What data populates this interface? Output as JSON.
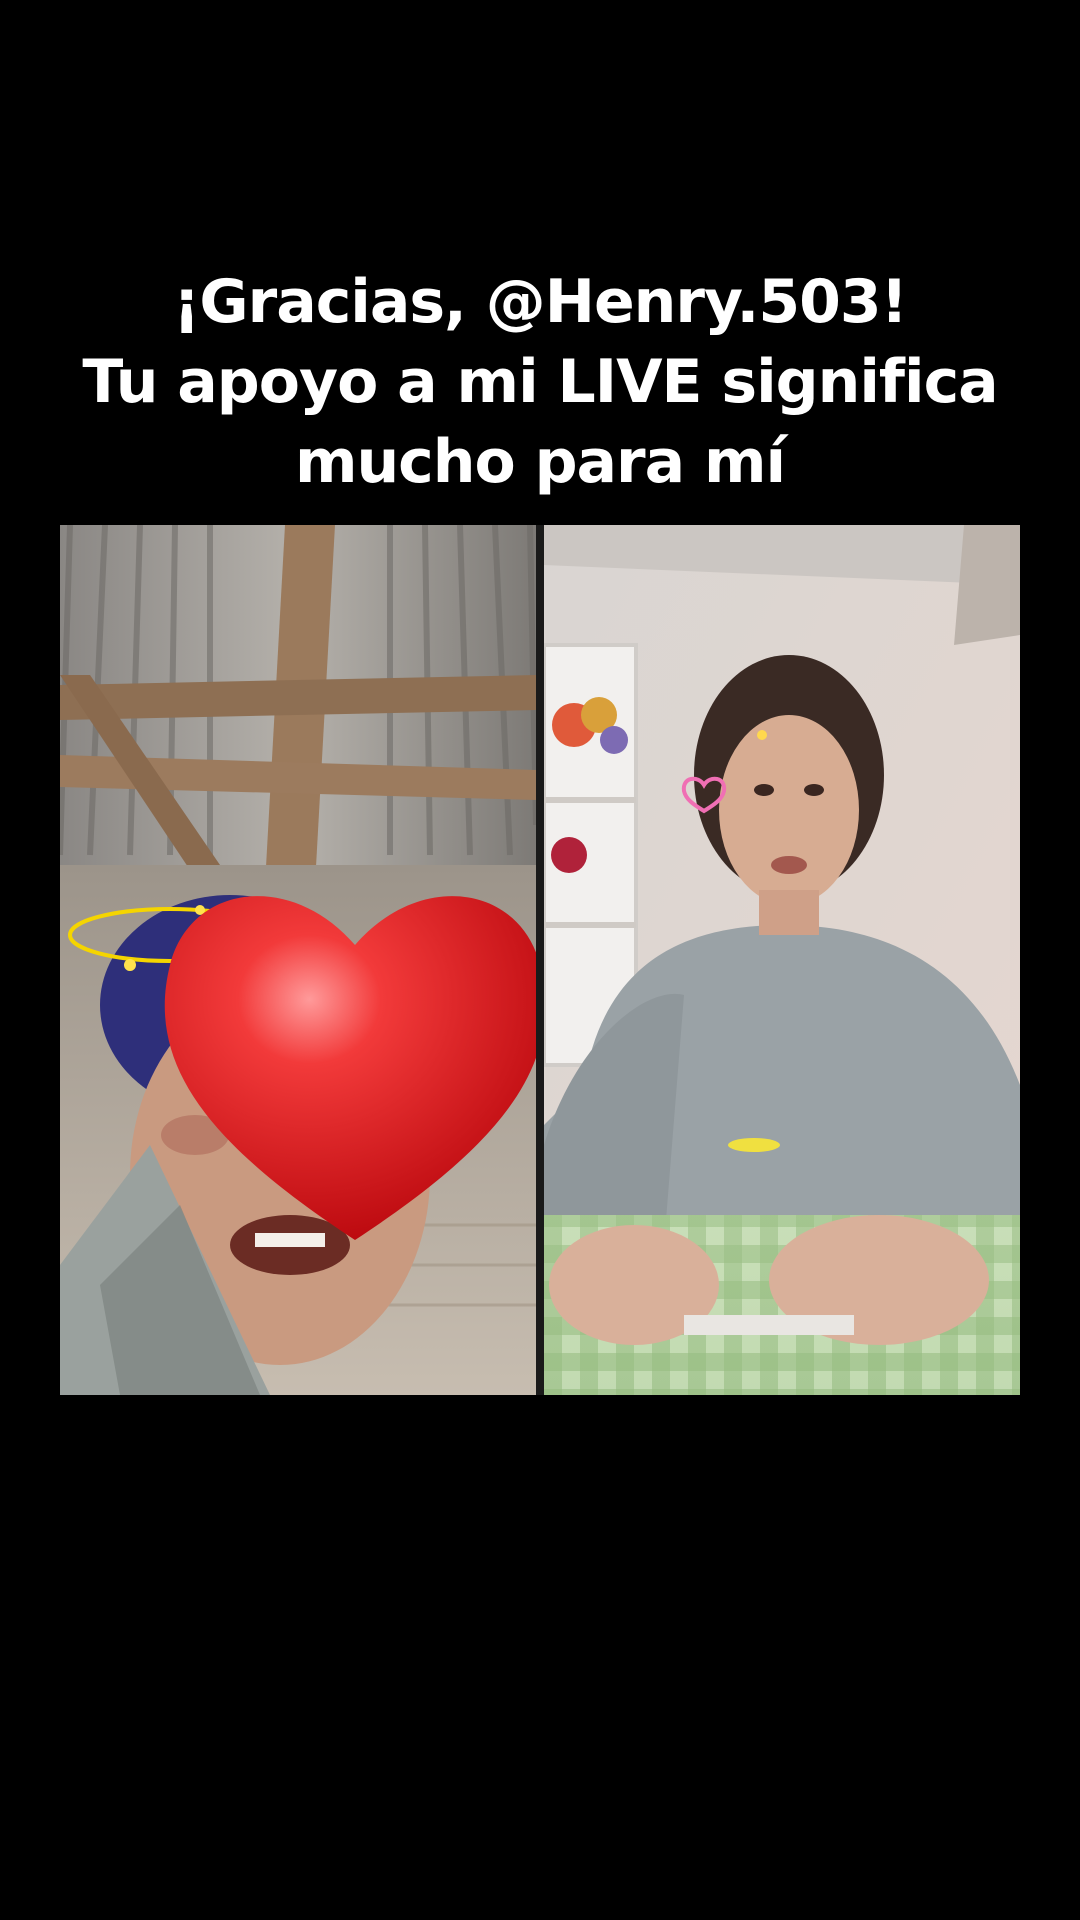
{
  "caption": {
    "line1": "¡Gracias, @Henry.503!",
    "line2": "Tu apoyo a mi LIVE significa",
    "line3": "mucho para mí"
  },
  "live": {
    "left_feed": {
      "subject": "guest-camera",
      "overlay_icon": "red-heart-icon"
    },
    "right_feed": {
      "subject": "host-camera",
      "overlay_icon": "pink-heart-sticker-icon"
    }
  },
  "colors": {
    "background": "#000000",
    "caption_text": "#ffffff",
    "heart": "#e0161b"
  }
}
